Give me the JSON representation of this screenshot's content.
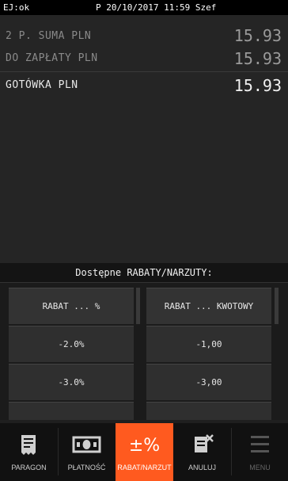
{
  "statusbar": {
    "left": "EJ:ok",
    "right": "P 20/10/2017 11:59 Szef"
  },
  "summary": {
    "rows": [
      {
        "label": "2 P. SUMA PLN",
        "value": "15.93"
      },
      {
        "label": "DO ZAPŁATY PLN",
        "value": "15.93"
      },
      {
        "label": "GOTÓWKA PLN",
        "value": "15.93"
      }
    ]
  },
  "discounts": {
    "title": "Dostępne RABATY/NARZUTY:",
    "left": {
      "header": "RABAT ... %",
      "items": [
        "-2.0%",
        "-3.0%"
      ]
    },
    "right": {
      "header": "RABAT ... KWOTOWY",
      "items": [
        "-1,00",
        "-3,00"
      ]
    }
  },
  "tabs": [
    {
      "label": "PARAGON",
      "icon": "receipt-icon"
    },
    {
      "label": "PŁATNOŚĆ",
      "icon": "banknote-icon"
    },
    {
      "label": "RABAT/NARZUT",
      "icon": "plus-minus-percent-icon",
      "active": true
    },
    {
      "label": "ANULUJ",
      "icon": "cancel-receipt-icon"
    },
    {
      "label": "MENU",
      "icon": "hamburger-menu-icon"
    }
  ],
  "colors": {
    "accent": "#ff5a1f",
    "background": "#1f1f1f"
  }
}
